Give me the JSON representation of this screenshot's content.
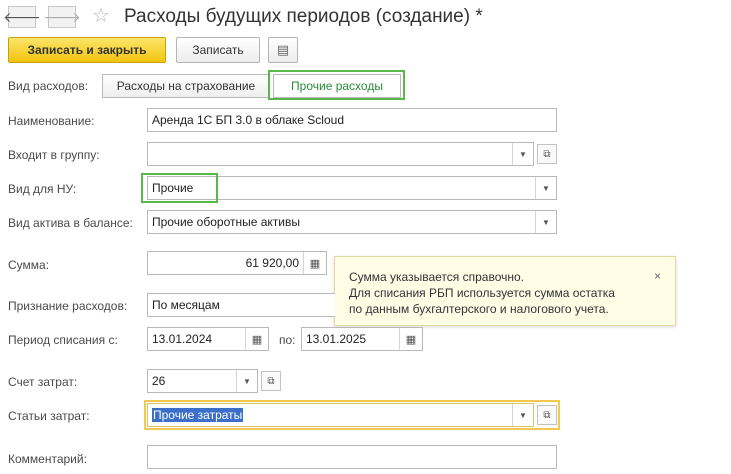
{
  "title": {
    "back_glyph": "🡐",
    "forward_glyph": "🡒",
    "star_glyph": "☆",
    "text": "Расходы будущих периодов (создание) *"
  },
  "toolbar": {
    "save_close_label": "Записать и закрыть",
    "save_label": "Записать",
    "menu_glyph": "▤"
  },
  "expense_type": {
    "label": "Вид расходов:",
    "options": [
      "Расходы на страхование",
      "Прочие расходы"
    ],
    "selected": "Прочие расходы"
  },
  "name": {
    "label": "Наименование:",
    "value": "Аренда 1С БП 3.0 в облаке Scloud"
  },
  "group": {
    "label": "Входит в группу:",
    "value": ""
  },
  "nu_type": {
    "label": "Вид для НУ:",
    "value": "Прочие"
  },
  "asset_type": {
    "label": "Вид актива в балансе:",
    "value": "Прочие оборотные активы"
  },
  "amount": {
    "label": "Сумма:",
    "value": "61 920,00"
  },
  "recognition": {
    "label": "Признание расходов:",
    "value": "По месяцам"
  },
  "period": {
    "label": "Период списания с:",
    "from": "13.01.2024",
    "to_label": "по:",
    "to": "13.01.2025"
  },
  "cost_account": {
    "label": "Счет затрат:",
    "value": "26"
  },
  "cost_items": {
    "label": "Статьи затрат:",
    "value": "Прочие затраты"
  },
  "comment": {
    "label": "Комментарий:",
    "value": ""
  },
  "tooltip": {
    "lines": [
      "Сумма указывается справочно.",
      "Для списания РБП используется сумма остатка",
      "по данным бухгалтерского и налогового учета."
    ],
    "close_glyph": "×"
  },
  "glyphs": {
    "dropdown": "▼",
    "open": "⧉",
    "calendar": "▦",
    "calculator": "▦"
  },
  "colors": {
    "highlight_green": "#57b947",
    "highlight_yellow": "#f2c94c",
    "primary_button": "#f1c40f"
  }
}
